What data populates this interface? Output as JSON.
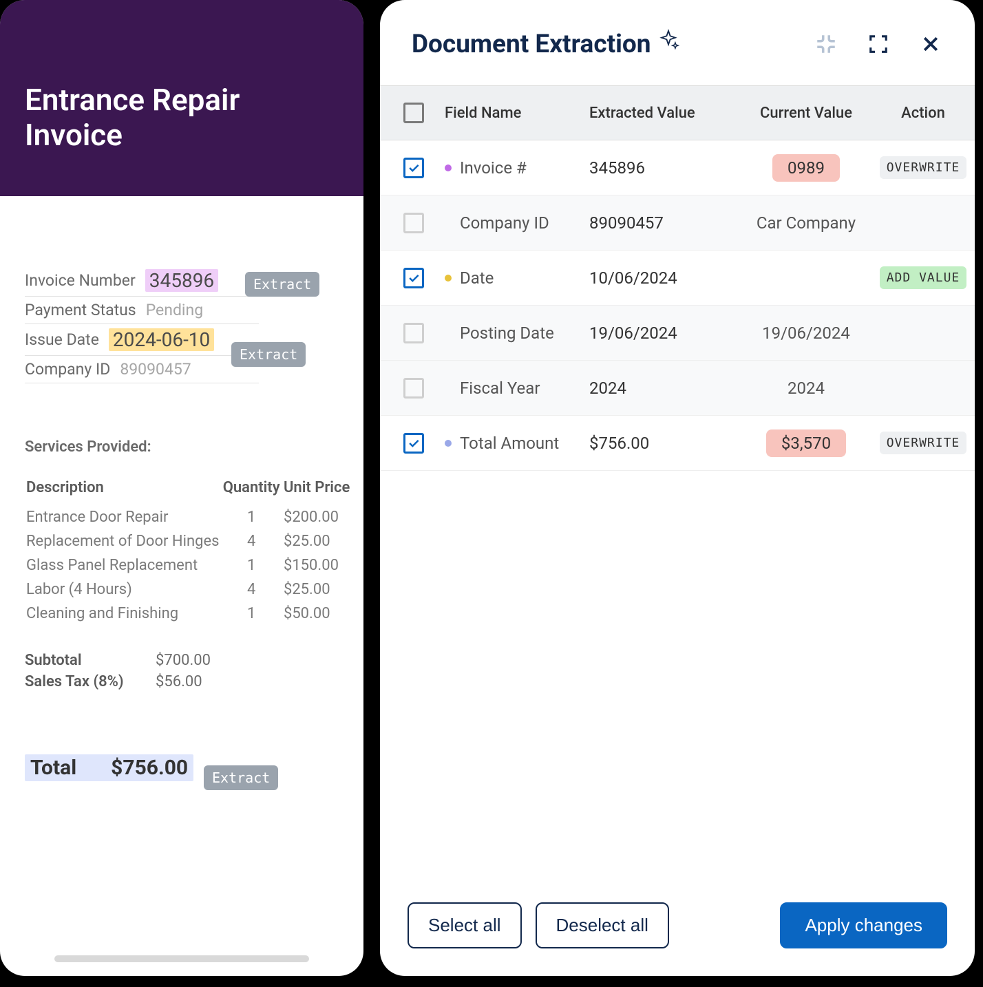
{
  "doc": {
    "title": "Entrance Repair Invoice",
    "fields": {
      "invoice_number_label": "Invoice Number",
      "invoice_number_value": "345896",
      "payment_status_label": "Payment Status",
      "payment_status_value": "Pending",
      "issue_date_label": "Issue Date",
      "issue_date_value": "2024-06-10",
      "company_id_label": "Company ID",
      "company_id_value": "89090457"
    },
    "extract_label": "Extract",
    "services_heading": "Services Provided:",
    "services_headers": {
      "desc": "Description",
      "qty": "Quantity",
      "price": "Unit Price"
    },
    "services": [
      {
        "desc": "Entrance Door Repair",
        "qty": "1",
        "price": "$200.00"
      },
      {
        "desc": "Replacement of Door Hinges",
        "qty": "4",
        "price": "$25.00"
      },
      {
        "desc": "Glass Panel Replacement",
        "qty": "1",
        "price": "$150.00"
      },
      {
        "desc": "Labor (4 Hours)",
        "qty": "4",
        "price": "$25.00"
      },
      {
        "desc": "Cleaning and Finishing",
        "qty": "1",
        "price": "$50.00"
      }
    ],
    "subtotal_label": "Subtotal",
    "subtotal_value": "$700.00",
    "tax_label": "Sales Tax (8%)",
    "tax_value": "$56.00",
    "total_label": "Total",
    "total_value": "$756.00"
  },
  "panel": {
    "title": "Document Extraction",
    "headers": {
      "field": "Field Name",
      "extracted": "Extracted Value",
      "current": "Current Value",
      "action": "Action"
    },
    "rows": [
      {
        "checked": true,
        "dot": "purple",
        "field": "Invoice #",
        "extracted": "345896",
        "current": "0989",
        "current_pill": true,
        "action": "OVERWRITE",
        "action_style": "default"
      },
      {
        "checked": false,
        "dot": "",
        "field": "Company ID",
        "extracted": "89090457",
        "current": "Car Company",
        "current_pill": false,
        "action": "",
        "action_style": ""
      },
      {
        "checked": true,
        "dot": "yellow",
        "field": "Date",
        "extracted": "10/06/2024",
        "current": "",
        "current_pill": false,
        "action": "ADD VALUE",
        "action_style": "add"
      },
      {
        "checked": false,
        "dot": "",
        "field": "Posting Date",
        "extracted": "19/06/2024",
        "current": "19/06/2024",
        "current_pill": false,
        "action": "",
        "action_style": ""
      },
      {
        "checked": false,
        "dot": "",
        "field": "Fiscal Year",
        "extracted": "2024",
        "current": "2024",
        "current_pill": false,
        "action": "",
        "action_style": ""
      },
      {
        "checked": true,
        "dot": "blue",
        "field": "Total Amount",
        "extracted": "$756.00",
        "current": "$3,570",
        "current_pill": true,
        "action": "OVERWRITE",
        "action_style": "default"
      }
    ],
    "footer": {
      "select_all": "Select all",
      "deselect_all": "Deselect all",
      "apply": "Apply changes"
    }
  }
}
